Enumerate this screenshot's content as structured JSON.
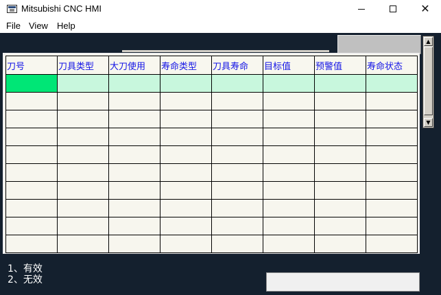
{
  "window": {
    "title": "Mitsubishi CNC HMI",
    "icon": "app-icon",
    "controls": {
      "minimize": "minimize-icon",
      "maximize": "maximize-icon",
      "close": "close-icon"
    }
  },
  "menu": {
    "items": [
      {
        "label": "File"
      },
      {
        "label": "View"
      },
      {
        "label": "Help"
      }
    ]
  },
  "table": {
    "headers": [
      "刀号",
      "刀具类型",
      "大刀使用",
      "寿命类型",
      "刀具寿命",
      "目标值",
      "预警值",
      "寿命状态"
    ],
    "rows": [
      [
        "",
        "",
        "",
        "",
        "",
        "",
        "",
        ""
      ],
      [
        "",
        "",
        "",
        "",
        "",
        "",
        "",
        ""
      ],
      [
        "",
        "",
        "",
        "",
        "",
        "",
        "",
        ""
      ],
      [
        "",
        "",
        "",
        "",
        "",
        "",
        "",
        ""
      ],
      [
        "",
        "",
        "",
        "",
        "",
        "",
        "",
        ""
      ],
      [
        "",
        "",
        "",
        "",
        "",
        "",
        "",
        ""
      ],
      [
        "",
        "",
        "",
        "",
        "",
        "",
        "",
        ""
      ],
      [
        "",
        "",
        "",
        "",
        "",
        "",
        "",
        ""
      ],
      [
        "",
        "",
        "",
        "",
        "",
        "",
        "",
        ""
      ],
      [
        "",
        "",
        "",
        "",
        "",
        "",
        "",
        ""
      ]
    ],
    "selected_row": 0
  },
  "notes": {
    "line1": "1、有效",
    "line2": "2、无效"
  },
  "input": {
    "value": ""
  },
  "colors": {
    "background": "#14202e",
    "header_text": "#1515e6",
    "selected_row": "#c8f7dd",
    "current_cell": "#00e676",
    "cell": "#f7f6ee"
  }
}
